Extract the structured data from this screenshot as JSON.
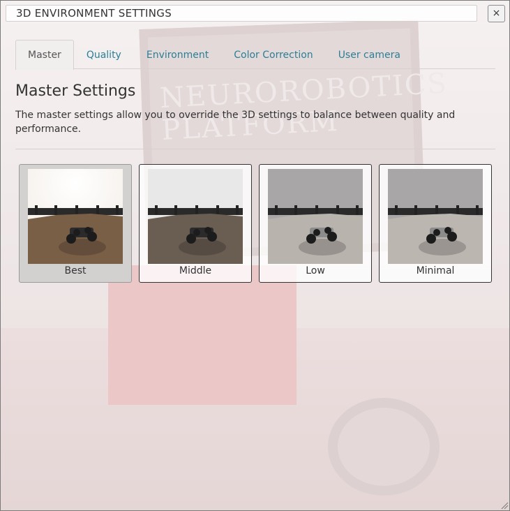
{
  "dialog": {
    "title": "3D ENVIRONMENT SETTINGS",
    "close_label": "×"
  },
  "tabs": [
    {
      "label": "Master",
      "active": true
    },
    {
      "label": "Quality",
      "active": false
    },
    {
      "label": "Environment",
      "active": false
    },
    {
      "label": "Color Correction",
      "active": false
    },
    {
      "label": "User camera",
      "active": false
    }
  ],
  "master": {
    "heading": "Master Settings",
    "description": "The master settings allow you to override the 3D settings to balance between quality and performance."
  },
  "presets": [
    {
      "label": "Best",
      "selected": true,
      "sky": "#f4efe9",
      "ground": "#7a5f47"
    },
    {
      "label": "Middle",
      "selected": false,
      "sky": "#e9e8e8",
      "ground": "#6a5d52"
    },
    {
      "label": "Low",
      "selected": false,
      "sky": "#a9a6a7",
      "ground": "#b9b3ad"
    },
    {
      "label": "Minimal",
      "selected": false,
      "sky": "#a9a6a7",
      "ground": "#bcb6b0"
    }
  ],
  "background_text": "NEUROROBOTICS PLATFORM",
  "colors": {
    "accent": "#2a7f96",
    "selected_bg": "#d3d0d0"
  }
}
